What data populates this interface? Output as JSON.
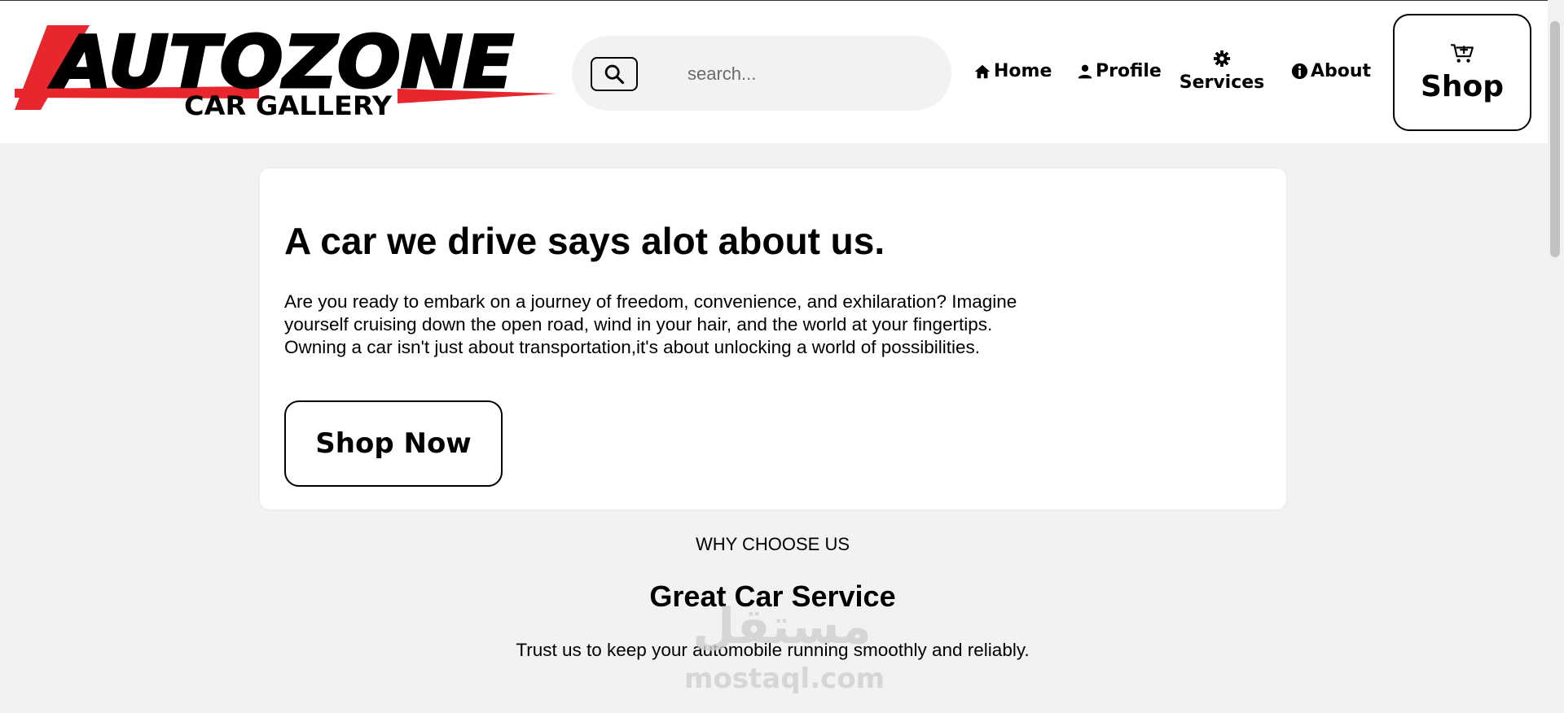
{
  "logo": {
    "wordmark": "AUTOZONE",
    "sub": "CAR GALLERY",
    "brand_red": "#e8262e"
  },
  "search": {
    "placeholder": "search...",
    "icon": "search-icon"
  },
  "nav": {
    "home": "Home",
    "profile": "Profile",
    "services": "Services",
    "about": "About"
  },
  "shop": {
    "label": "Shop",
    "icon": "cart-plus-icon"
  },
  "hero": {
    "title": "A car we drive says alot about us.",
    "body": "Are you ready to embark on a journey of freedom, convenience, and exhilaration? Imagine yourself cruising down the open road, wind in your hair, and the world at your fingertips. Owning a car isn't just about transportation,it's about unlocking a world of possibilities.",
    "cta": "Shop Now"
  },
  "why": {
    "kicker": "WHY CHOOSE US",
    "title": "Great Car Service",
    "desc": "Trust us to keep your automobile running smoothly and reliably."
  },
  "watermark": {
    "arabic": "مستقل",
    "latin": "mostaql.com"
  }
}
